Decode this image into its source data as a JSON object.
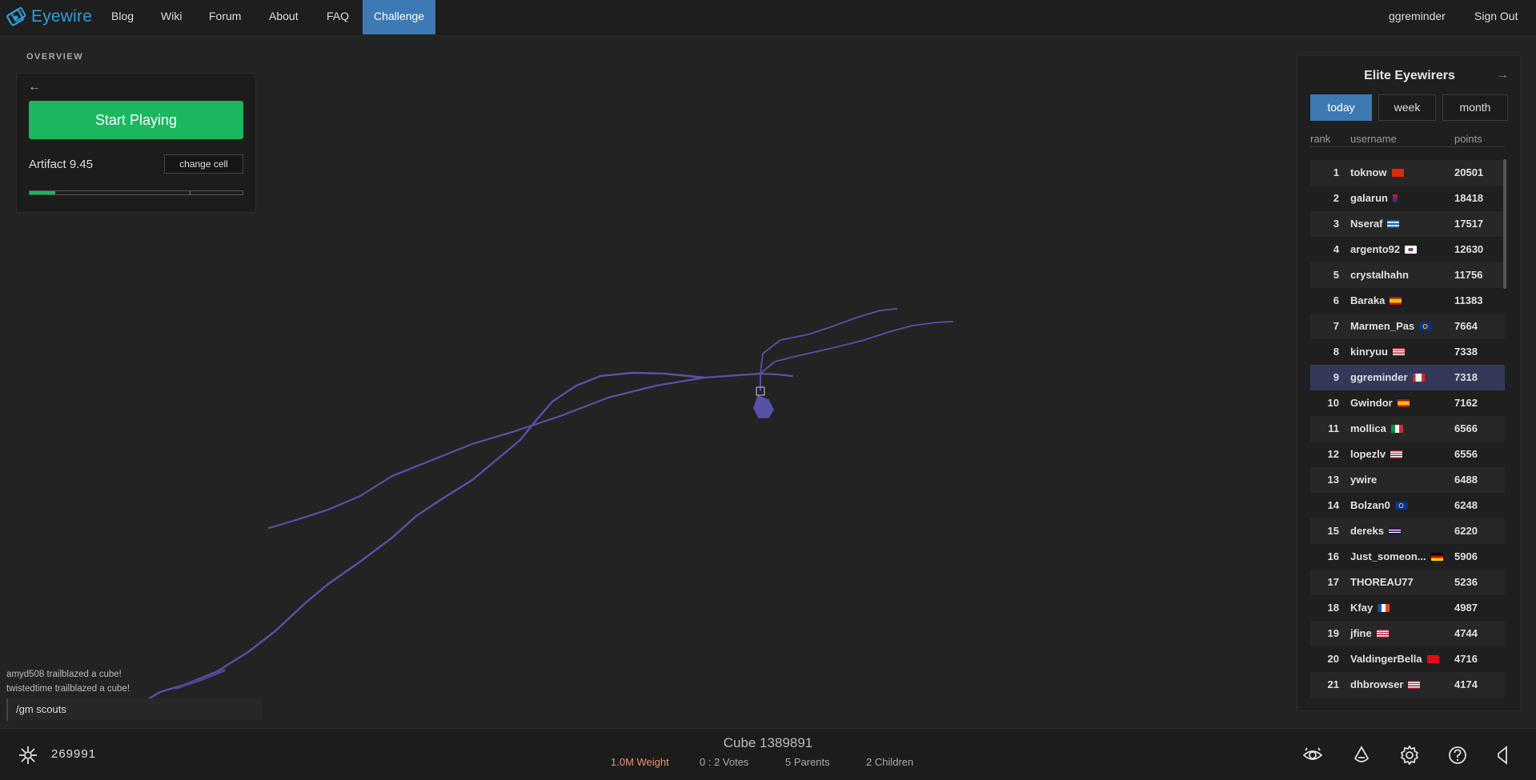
{
  "nav": {
    "logo_text": "Eyewire",
    "links": [
      "Blog",
      "Wiki",
      "Forum",
      "About",
      "FAQ",
      "Challenge"
    ],
    "active_link": "Challenge",
    "username": "ggreminder",
    "sign_out": "Sign Out"
  },
  "overview": {
    "heading": "OVERVIEW",
    "back_arrow": "←",
    "start_button": "Start Playing",
    "cell_name": "Artifact 9.45",
    "change_cell_button": "change cell",
    "progress_fraction": 0.12
  },
  "chat": {
    "messages": [
      "amyd508 trailblazed a cube!",
      "twistedtime trailblazed a cube!"
    ],
    "input_value": "/gm scouts"
  },
  "leaderboard": {
    "title": "Elite Eyewirers",
    "next_arrow": "→",
    "tabs": [
      "today",
      "week",
      "month"
    ],
    "active_tab": "today",
    "columns": [
      "rank",
      "username",
      "points"
    ],
    "rows": [
      {
        "rank": "1",
        "username": "toknow",
        "flag": "cn",
        "points": "20501"
      },
      {
        "rank": "2",
        "username": "galarun",
        "flag": "np",
        "points": "18418"
      },
      {
        "rank": "3",
        "username": "Nseraf",
        "flag": "gr",
        "points": "17517"
      },
      {
        "rank": "4",
        "username": "argento92",
        "flag": "kr",
        "points": "12630"
      },
      {
        "rank": "5",
        "username": "crystalhahn",
        "flag": "",
        "points": "11756"
      },
      {
        "rank": "6",
        "username": "Baraka",
        "flag": "es",
        "points": "11383"
      },
      {
        "rank": "7",
        "username": "Marmen_Pas",
        "flag": "eu",
        "points": "7664"
      },
      {
        "rank": "8",
        "username": "kinryuu",
        "flag": "us",
        "points": "7338"
      },
      {
        "rank": "9",
        "username": "ggreminder",
        "flag": "ca",
        "points": "7318"
      },
      {
        "rank": "10",
        "username": "Gwindor",
        "flag": "es",
        "points": "7162"
      },
      {
        "rank": "11",
        "username": "mollica",
        "flag": "it",
        "points": "6566"
      },
      {
        "rank": "12",
        "username": "lopezlv",
        "flag": "us",
        "points": "6556"
      },
      {
        "rank": "13",
        "username": "ywire",
        "flag": "",
        "points": "6488"
      },
      {
        "rank": "14",
        "username": "Bolzan0",
        "flag": "eu",
        "points": "6248"
      },
      {
        "rank": "15",
        "username": "dereks",
        "flag": "gb",
        "points": "6220"
      },
      {
        "rank": "16",
        "username": "Just_someon...",
        "flag": "de",
        "points": "5906"
      },
      {
        "rank": "17",
        "username": "THOREAU77",
        "flag": "",
        "points": "5236"
      },
      {
        "rank": "18",
        "username": "Kfay",
        "flag": "fr",
        "points": "4987"
      },
      {
        "rank": "19",
        "username": "jfine",
        "flag": "us",
        "points": "4744"
      },
      {
        "rank": "20",
        "username": "ValdingerBella",
        "flag": "tr",
        "points": "4716"
      },
      {
        "rank": "21",
        "username": "dhbrowser",
        "flag": "us",
        "points": "4174"
      }
    ],
    "highlight_username": "ggreminder"
  },
  "bottom": {
    "score": "269991",
    "cube_title": "Cube 1389891",
    "weight": "1.0M Weight",
    "votes": "0 : 2 Votes",
    "parents": "5 Parents",
    "children": "2 Children",
    "icons": [
      "eye-icon",
      "drop-icon",
      "gear-icon",
      "help-icon",
      "sound-icon"
    ]
  },
  "colors": {
    "accent_blue": "#3d7ab4",
    "start_green": "#1bb660",
    "neuron_purple": "#5b50a8",
    "weight_orange": "#e9936f",
    "logo_blue": "#2e9fd8"
  }
}
